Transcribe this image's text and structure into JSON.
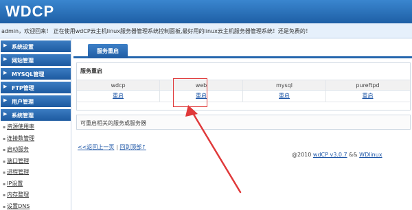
{
  "header": {
    "logo": "WDCP"
  },
  "welcome": {
    "text": "admin，欢迎回来！ 正在使用wdCP云主机linux服务器管理系统控制面板,最好用的linux云主机服务器管理系统！还是免费的！"
  },
  "sidebar": {
    "items": [
      {
        "label": "系统设置"
      },
      {
        "label": "网站管理"
      },
      {
        "label": "MYSQL管理"
      },
      {
        "label": "FTP管理"
      },
      {
        "label": "用户管理"
      },
      {
        "label": "系统管理"
      }
    ],
    "sub_items": [
      {
        "label": "资源使用率"
      },
      {
        "label": "连接数管理"
      },
      {
        "label": "启动服务"
      },
      {
        "label": "端口管理"
      },
      {
        "label": "进程管理"
      },
      {
        "label": "IP设置"
      },
      {
        "label": "内存整理"
      },
      {
        "label": "设置DNS"
      }
    ]
  },
  "main": {
    "tab": "服务重启",
    "panel_title": "服务重启",
    "services": [
      {
        "name": "wdcp",
        "action": "重启"
      },
      {
        "name": "web",
        "action": "重启"
      },
      {
        "name": "mysql",
        "action": "重启"
      },
      {
        "name": "pureftpd",
        "action": "重启"
      }
    ],
    "note": "可重启相关的服务或服务器",
    "back_link": "<<返回上一页",
    "sep": "|",
    "top_link": "回到顶部↑",
    "footer_prefix": "@2010",
    "footer_wdcp": "wdCP v3.0.7",
    "footer_mid": "&&",
    "footer_wdlinux": "WDlinux"
  },
  "colors": {
    "header": "#2a6fb5",
    "sidebar_item": "#2566ad",
    "annotation": "#e0393a",
    "link": "#1b54a6"
  }
}
